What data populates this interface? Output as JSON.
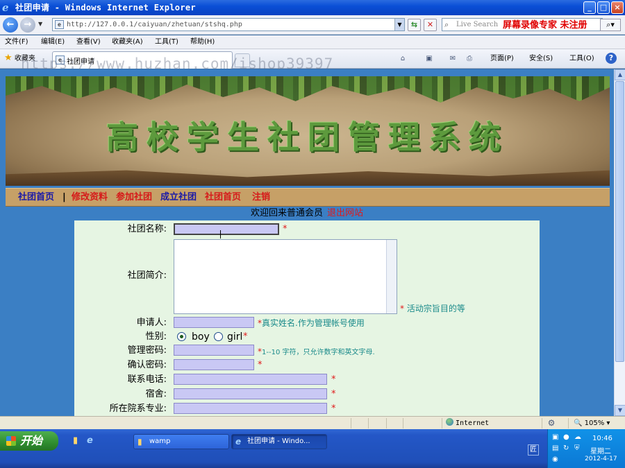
{
  "window": {
    "title": "社团申请 - Windows Internet Explorer",
    "minimize": "_",
    "maximize": "□",
    "close": "×"
  },
  "address": {
    "url": "http://127.0.0.1/caiyuan/zhetuan/stshq.php",
    "search_placeholder": "Live Search",
    "overlay_text": "屏幕录像专家 未注册"
  },
  "menubar": [
    "文件(F)",
    "编辑(E)",
    "查看(V)",
    "收藏夹(A)",
    "工具(T)",
    "帮助(H)"
  ],
  "tabs": {
    "favorites_label": "收藏夹",
    "active_tab": "社团申请"
  },
  "commandbar": {
    "page": "页面(P)",
    "safety": "安全(S)",
    "tools": "工具(O)"
  },
  "watermark": "https://www.huzhan.com/ishop39397",
  "banner": {
    "title": "高校学生社团管理系统"
  },
  "nav": {
    "items": [
      {
        "label": "社团首页",
        "color": "blue"
      },
      {
        "label": "|",
        "color": "black"
      },
      {
        "label": "修改资料",
        "color": "red"
      },
      {
        "label": "参加社团",
        "color": "red"
      },
      {
        "label": "成立社团",
        "color": "blue"
      },
      {
        "label": "社团首页",
        "color": "red"
      },
      {
        "label": "注销",
        "color": "red"
      }
    ]
  },
  "welcome": {
    "text": "欢迎回来普通会员",
    "logout": "退出网站"
  },
  "form": {
    "club_name_label": "社团名称:",
    "club_intro_label": "社团简介:",
    "club_intro_hint": "活动宗旨目的等",
    "applicant_label": "申请人:",
    "applicant_hint": "真实姓名.作为管理帐号使用",
    "gender_label": "性别:",
    "gender_options": [
      "boy",
      "girl"
    ],
    "gender_selected": "boy",
    "password_label": "管理密码:",
    "password_hint": "1--10 字符，只允许数字和英文字母.",
    "confirm_label": "确认密码:",
    "phone_label": "联系电话:",
    "dorm_label": "宿舍:",
    "major_label": "所在院系专业:",
    "required_mark": "*"
  },
  "status": {
    "zone": "Internet",
    "zoom": "105%"
  },
  "taskbar": {
    "start": "开始",
    "buttons": [
      {
        "label": "wamp",
        "active": false
      },
      {
        "label": "社团申请 - Windo...",
        "active": true
      }
    ],
    "time": "10:46",
    "day": "星期二",
    "date": "2012-4-17"
  },
  "colors": {
    "page_bg": "#3b7fc4",
    "nav_bg": "#c6a067",
    "form_bg": "#e6f5e3",
    "input_bg": "#c9c8f4",
    "required": "#e01a1a",
    "hint": "#1a8a8a"
  }
}
